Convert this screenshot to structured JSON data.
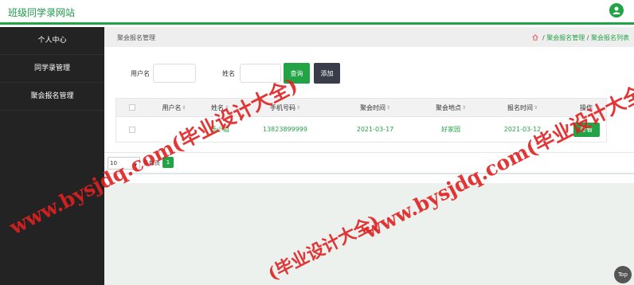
{
  "header": {
    "site_title": "班级同学录网站",
    "avatar_icon": "user-icon",
    "accent_color": "#22a345"
  },
  "sidebar": {
    "items": [
      {
        "label": "个人中心"
      },
      {
        "label": "同学录管理"
      },
      {
        "label": "聚会报名管理"
      }
    ]
  },
  "breadcrumb": {
    "page_name": "聚会报名管理",
    "home_icon": "home-icon",
    "level1": "聚会报名管理",
    "level2": "聚会报名列表",
    "sep": "/"
  },
  "search": {
    "username_label": "用户名",
    "username_value": "",
    "name_label": "姓名",
    "name_value": "",
    "query_button": "查询",
    "add_button": "添加"
  },
  "table": {
    "columns": [
      "用户名",
      "姓名",
      "手机号码",
      "聚会时间",
      "聚会地点",
      "报名时间",
      "操作"
    ],
    "rows": [
      {
        "username": "",
        "name": "杨小姐",
        "phone": "13823899999",
        "party_time": "2021-03-17",
        "location": "好家园",
        "signup_time": "2021-03-12",
        "action": "查看"
      }
    ]
  },
  "pager": {
    "page_size": "10",
    "per_page_label": "条每页",
    "current_page": "1"
  },
  "watermarks": [
    "www.bysjdq.com(毕业设计大全)",
    "www.bysjdq.com(毕业设计大全)",
    "(毕业设计大全)"
  ],
  "top_button": "Top"
}
